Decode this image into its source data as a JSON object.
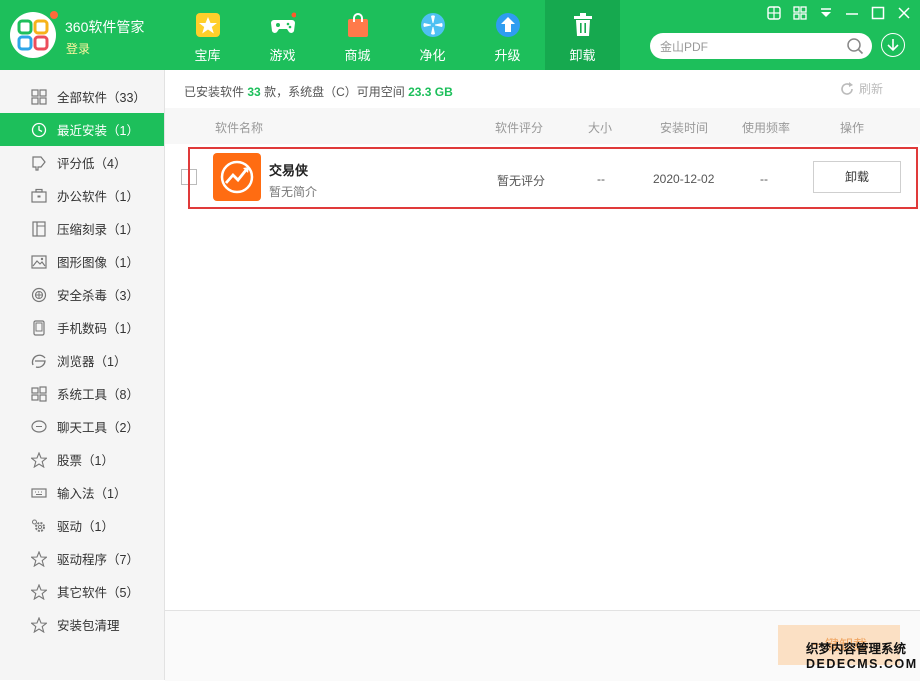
{
  "header": {
    "title": "360软件管家",
    "login": "登录",
    "nav": [
      {
        "label": "宝库",
        "icon": "star-icon"
      },
      {
        "label": "游戏",
        "icon": "gamepad-icon"
      },
      {
        "label": "商城",
        "icon": "shopping-bag-icon"
      },
      {
        "label": "净化",
        "icon": "fan-icon"
      },
      {
        "label": "升级",
        "icon": "upgrade-arrow-icon"
      },
      {
        "label": "卸载",
        "icon": "trash-icon",
        "active": true
      }
    ],
    "search_text": "金山PDF"
  },
  "sidebar": {
    "items": [
      {
        "label": "全部软件（33）",
        "icon": "grid-icon"
      },
      {
        "label": "最近安装（1）",
        "icon": "clock-icon",
        "active": true
      },
      {
        "label": "评分低（4）",
        "icon": "thumb-down-icon"
      },
      {
        "label": "办公软件（1）",
        "icon": "briefcase-icon"
      },
      {
        "label": "压缩刻录（1）",
        "icon": "archive-icon"
      },
      {
        "label": "图形图像（1）",
        "icon": "image-icon"
      },
      {
        "label": "安全杀毒（3）",
        "icon": "shield-icon"
      },
      {
        "label": "手机数码（1）",
        "icon": "phone-icon"
      },
      {
        "label": "浏览器（1）",
        "icon": "browser-icon"
      },
      {
        "label": "系统工具（8）",
        "icon": "windows-icon"
      },
      {
        "label": "聊天工具（2）",
        "icon": "chat-icon"
      },
      {
        "label": "股票（1）",
        "icon": "star-outline-icon"
      },
      {
        "label": "输入法（1）",
        "icon": "keyboard-icon"
      },
      {
        "label": "驱动（1）",
        "icon": "gear-icon"
      },
      {
        "label": "驱动程序（7）",
        "icon": "star-outline-icon"
      },
      {
        "label": "其它软件（5）",
        "icon": "star-outline-icon"
      },
      {
        "label": "安装包清理",
        "icon": "star-outline-icon"
      }
    ]
  },
  "summary": {
    "prefix": "已安装软件",
    "count": "33",
    "mid": "款，系统盘（C）可用空间",
    "space": "23.3 GB"
  },
  "refresh_label": "刷新",
  "table": {
    "headers": {
      "name": "软件名称",
      "rating": "软件评分",
      "size": "大小",
      "install_time": "安装时间",
      "frequency": "使用频率",
      "action": "操作"
    },
    "rows": [
      {
        "name": "交易侠",
        "desc": "暂无简介",
        "rating": "暂无评分",
        "size": "--",
        "install_time": "2020-12-02",
        "frequency": "--",
        "action": "卸载"
      }
    ]
  },
  "footer": {
    "onekey": "一键卸载"
  },
  "watermark": {
    "line1": "织梦内容管理系统",
    "line2": "DEDECMS.COM"
  },
  "colors": {
    "brand": "#1dbf5b",
    "highlight": "#e03a3a",
    "app_icon": "#ff6c12"
  }
}
